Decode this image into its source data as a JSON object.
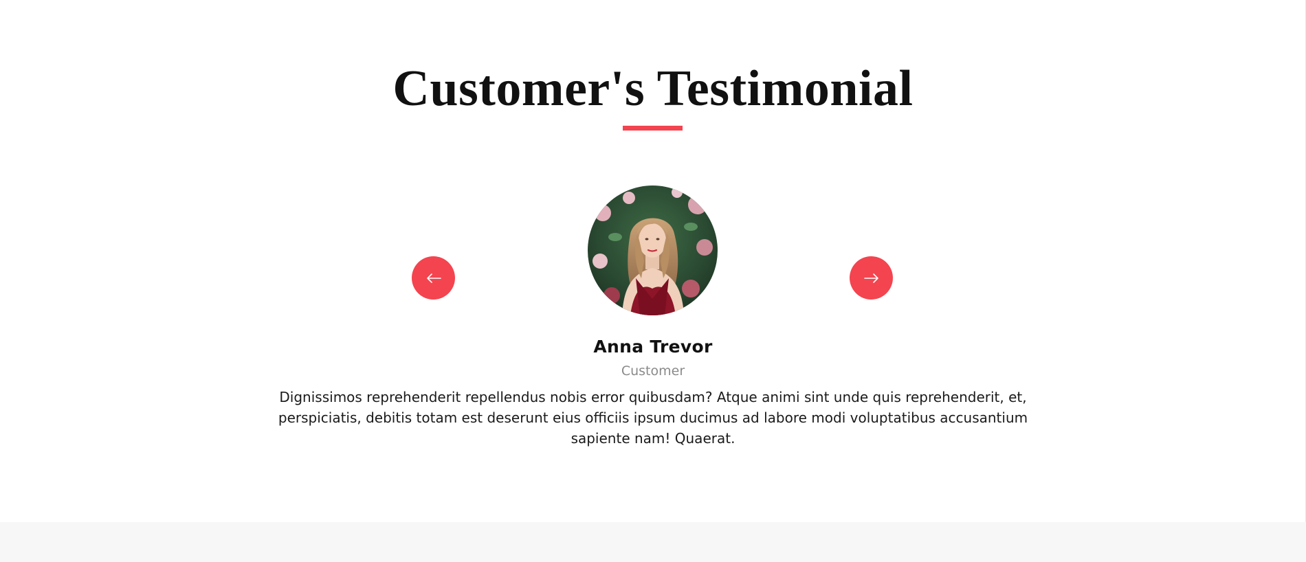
{
  "section": {
    "title": "Customer's Testimonial"
  },
  "carousel": {
    "prev_icon": "arrow-left-icon",
    "next_icon": "arrow-right-icon"
  },
  "testimonial": {
    "name": "Anna Trevor",
    "role": "Customer",
    "text": "Dignissimos reprehenderit repellendus nobis error quibusdam? Atque animi sint unde quis reprehenderit, et, perspiciatis, debitis totam est deserunt eius officiis ipsum ducimus ad labore modi voluptatibus accusantium sapiente nam! Quaerat.",
    "avatar_icon": "customer-photo"
  },
  "colors": {
    "accent": "#f4444f",
    "title": "#111111",
    "muted": "#8a8a8a",
    "lower_background": "#f7f7f7"
  }
}
